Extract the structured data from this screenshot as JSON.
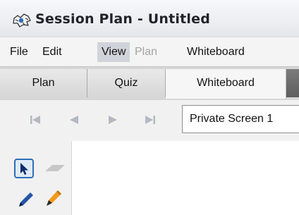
{
  "window": {
    "title": "Session Plan - Untitled",
    "app_icon": "session-plan-app-icon"
  },
  "menubar": {
    "items": [
      {
        "label": "File"
      },
      {
        "label": "Edit"
      },
      {
        "label": "View",
        "state": "active"
      },
      {
        "label": "Plan",
        "state": "disabled"
      },
      {
        "label": "Whiteboard"
      }
    ]
  },
  "tabs": {
    "items": [
      {
        "label": "Plan"
      },
      {
        "label": "Quiz"
      },
      {
        "label": "Whiteboard",
        "selected": true
      }
    ]
  },
  "navigation": {
    "buttons": [
      "first-page-icon",
      "previous-page-icon",
      "next-page-icon",
      "last-page-icon"
    ],
    "screen_select_value": "Private Screen 1"
  },
  "tools": {
    "items": [
      "pointer-tool-icon",
      "eraser-tool-icon",
      "pen-tool-icon",
      "highlighter-tool-icon"
    ],
    "selected": "pointer-tool-icon"
  },
  "colors": {
    "accent": "#2f6fb8",
    "highlighter": "#f39a1c",
    "pen": "#2456a6"
  }
}
